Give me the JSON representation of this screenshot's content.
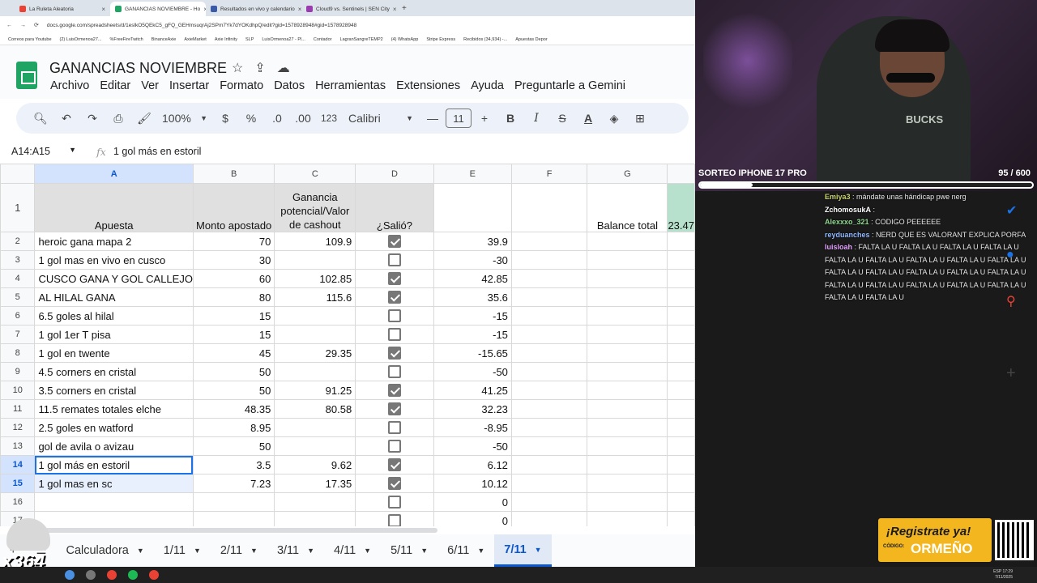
{
  "browser": {
    "tabs": [
      {
        "label": "La Ruleta Aleatoria",
        "color": "#e94235"
      },
      {
        "label": "GANANCIAS NOVIEMBRE - Ho",
        "color": "#1fa463"
      },
      {
        "label": "Resultados en vivo y calendario",
        "color": "#3b5ba9"
      },
      {
        "label": "Cloud9 vs. Sentinels | SEN City",
        "color": "#9b3bb0"
      }
    ],
    "url": "docs.google.com/spreadsheets/d/1eslkO5QEkC5_gFQ_GEHmsuqrAj2SPm7Yk7dYOKdhpQ/edit?gid=1578928948#gid=1578928948",
    "bookmarks": [
      "Correos para Youtube",
      "(2) LuisOrmenoa27...",
      "%FreeFireTwitch",
      "BinanceAxie",
      "AxieMarket",
      "Axie Infinity",
      "SLP",
      "LuisOrmenoa27 - Pl...",
      "Contador",
      "LagranSangreTEMP2",
      "(4) WhatsApp",
      "Stripe Express",
      "Recibidos (34,934) -...",
      "Apuestas Depor"
    ]
  },
  "sheets": {
    "title": "GANANCIAS NOVIEMBRE",
    "menu": [
      "Archivo",
      "Editar",
      "Ver",
      "Insertar",
      "Formato",
      "Datos",
      "Herramientas",
      "Extensiones",
      "Ayuda",
      "Preguntarle a Gemini"
    ],
    "toolbar": {
      "zoom": "100%",
      "currency": "$",
      "percent": "%",
      "dec_less": ".0",
      "dec_more": ".00",
      "format123": "123",
      "font": "Calibri",
      "font_size": "11"
    },
    "namebox": "A14:A15",
    "formula": "1 gol más en estoril",
    "columns": [
      "A",
      "B",
      "C",
      "D",
      "E",
      "F",
      "G"
    ],
    "headers": {
      "apuesta": "Apuesta",
      "monto": "Monto apostado",
      "ganancia_1": "Ganancia",
      "ganancia_2": "potencial/Valor",
      "ganancia_3": "de cashout",
      "salio": "¿Salió?",
      "balance_label": "Balance total",
      "balance_value": "23.47"
    },
    "rows": [
      {
        "n": "2",
        "a": "heroic gana mapa 2",
        "b": "70",
        "c": "109.9",
        "d": true,
        "e": "39.9"
      },
      {
        "n": "3",
        "a": "1 gol mas en vivo en cusco",
        "b": "30",
        "c": "",
        "d": false,
        "e": "-30"
      },
      {
        "n": "4",
        "a": "CUSCO GANA Y GOL CALLEJO",
        "b": "60",
        "c": "102.85",
        "d": true,
        "e": "42.85"
      },
      {
        "n": "5",
        "a": "AL HILAL GANA",
        "b": "80",
        "c": "115.6",
        "d": true,
        "e": "35.6"
      },
      {
        "n": "6",
        "a": "6.5 goles al hilal",
        "b": "15",
        "c": "",
        "d": false,
        "e": "-15"
      },
      {
        "n": "7",
        "a": "1 gol 1er T pisa",
        "b": "15",
        "c": "",
        "d": false,
        "e": "-15"
      },
      {
        "n": "8",
        "a": "1 gol en twente",
        "b": "45",
        "c": "29.35",
        "d": true,
        "e": "-15.65"
      },
      {
        "n": "9",
        "a": "4.5 corners en cristal",
        "b": "50",
        "c": "",
        "d": false,
        "e": "-50"
      },
      {
        "n": "10",
        "a": "3.5 corners en cristal",
        "b": "50",
        "c": "91.25",
        "d": true,
        "e": "41.25"
      },
      {
        "n": "11",
        "a": "11.5 remates totales elche",
        "b": "48.35",
        "c": "80.58",
        "d": true,
        "e": "32.23"
      },
      {
        "n": "12",
        "a": "2.5 goles en watford",
        "b": "8.95",
        "c": "",
        "d": false,
        "e": "-8.95"
      },
      {
        "n": "13",
        "a": "gol de avila o avizau",
        "b": "50",
        "c": "",
        "d": false,
        "e": "-50"
      },
      {
        "n": "14",
        "a": "1 gol más en estoril",
        "b": "3.5",
        "c": "9.62",
        "d": true,
        "e": "6.12"
      },
      {
        "n": "15",
        "a": "1 gol mas en sc",
        "b": "7.23",
        "c": "17.35",
        "d": true,
        "e": "10.12"
      },
      {
        "n": "16",
        "a": "",
        "b": "",
        "c": "",
        "d": false,
        "e": "0"
      },
      {
        "n": "17",
        "a": "",
        "b": "",
        "c": "",
        "d": false,
        "e": "0"
      }
    ],
    "sheet_tabs": [
      "Calculadora",
      "1/11",
      "2/11",
      "3/11",
      "4/11",
      "5/11",
      "6/11",
      "7/11"
    ],
    "active_tab": "7/11"
  },
  "stream": {
    "sorteo_label": "SORTEO IPHONE 17 PRO",
    "sorteo_count": "95  / 600",
    "sorteo_progress": 0.158,
    "shirt_text": "BUCKS",
    "chat": [
      {
        "user": "Emiya3",
        "msg": ": mándate unas hándicap pwe nerg"
      },
      {
        "user": "ZchomosukA",
        "msg": ":"
      },
      {
        "user": "Alexxxo_321",
        "msg": ": CODIGO PEEEEEE"
      },
      {
        "user": "reyduanches",
        "msg": ": NERD QUE ES VALORANT EXPLICA PORFA"
      },
      {
        "user": "luisloah",
        "msg": ": FALTA LA U FALTA LA U FALTA LA U FALTA LA U FALTA LA U FALTA LA U FALTA LA U FALTA LA U FALTA LA U FALTA LA U FALTA LA U FALTA LA U FALTA LA U FALTA LA U FALTA LA U FALTA LA U FALTA LA U FALTA LA U FALTA LA U FALTA LA U FALTA LA U"
      }
    ],
    "promo_title": "¡Registrate ya!",
    "promo_code_label": "CÓDIGO:",
    "promo_code": "ORMEÑO",
    "cat_text": "x364",
    "clock_time": "17:29",
    "clock_date": "7/11/2025",
    "lang": "ESP"
  }
}
